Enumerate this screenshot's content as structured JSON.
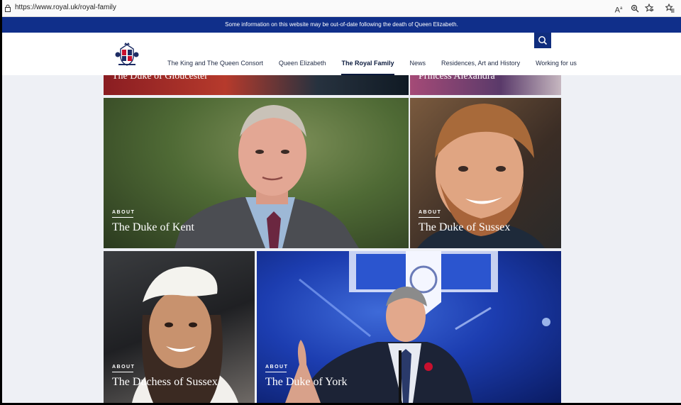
{
  "browser": {
    "url": "https://www.royal.uk/royal-family",
    "toolbar_icons": [
      "read-aloud-icon",
      "zoom-icon",
      "favorite-icon",
      "favorites-bar-icon"
    ]
  },
  "notice": {
    "text": "Some information on this website may be out-of-date following the death of Queen Elizabeth."
  },
  "header": {
    "nav": [
      {
        "label": "The King and The Queen Consort",
        "active": false
      },
      {
        "label": "Queen Elizabeth",
        "active": false
      },
      {
        "label": "The Royal Family",
        "active": true
      },
      {
        "label": "News",
        "active": false
      },
      {
        "label": "Residences, Art and History",
        "active": false
      },
      {
        "label": "Working for us",
        "active": false
      }
    ]
  },
  "tiles": {
    "partial_left": {
      "name": "The Duke of Gloucester"
    },
    "partial_right": {
      "name": "Princess Alexandra"
    },
    "kent": {
      "about": "ABOUT",
      "name": "The Duke of Kent"
    },
    "sussex": {
      "about": "ABOUT",
      "name": "The Duke of Sussex"
    },
    "duchess": {
      "about": "ABOUT",
      "name": "The Duchess of Sussex"
    },
    "york": {
      "about": "ABOUT",
      "name": "The Duke of York"
    }
  },
  "colors": {
    "notice_bar": "#102f8a",
    "nav_text": "#1f2a44",
    "search_button": "#0f2d7e"
  }
}
